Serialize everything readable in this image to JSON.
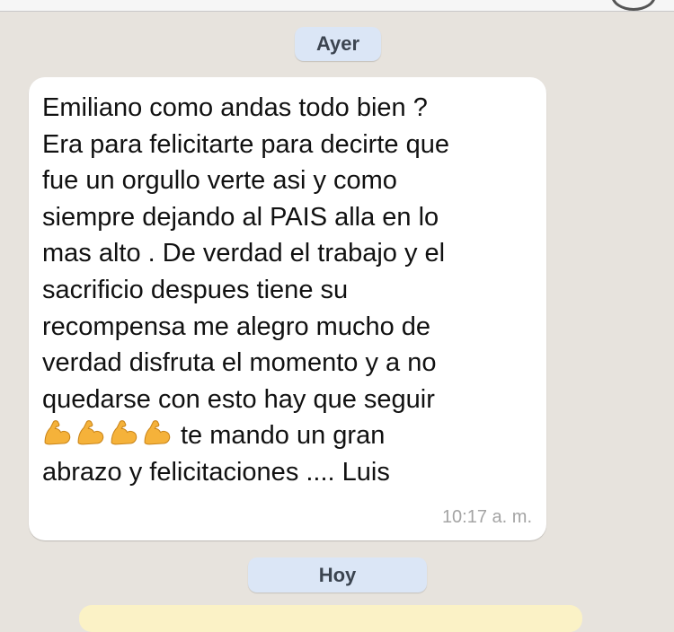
{
  "dates": {
    "yesterday": "Ayer",
    "today": "Hoy"
  },
  "message": {
    "lines": [
      "Emiliano como andas todo bien ?",
      "Era para felicitarte para decirte que",
      "fue un orgullo verte asi y como",
      "siempre dejando al PAIS alla en lo",
      "mas alto . De verdad el trabajo y el",
      "sacrificio despues tiene su",
      "recompensa me alegro mucho de",
      "verdad disfruta el momento y a no",
      "quedarse con esto hay que seguir"
    ],
    "emoji_icon": "flexed-biceps-icon",
    "emoji_count": 4,
    "after_emoji": "te mando un gran",
    "last_line": "abrazo y felicitaciones .... Luis",
    "time": "10:17 a. m."
  },
  "colors": {
    "background": "#e7e3dd",
    "bubble": "#ffffff",
    "date_badge": "#dbe6f6",
    "emoji": "#f5b23a"
  }
}
